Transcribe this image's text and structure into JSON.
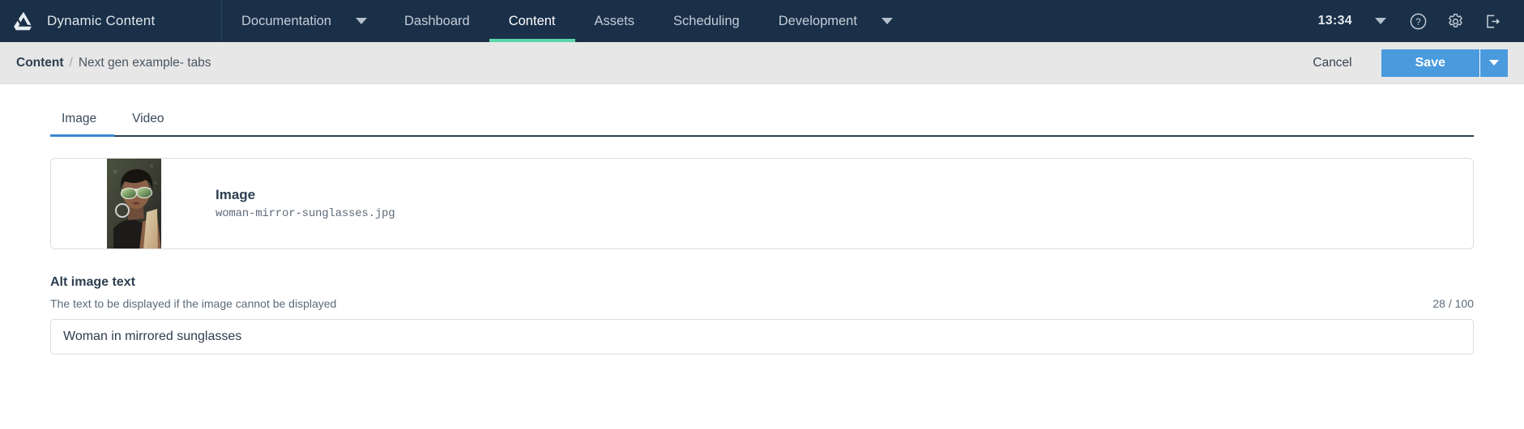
{
  "topnav": {
    "logo_icon": "amplience-triangle-logo-icon",
    "brand": "Dynamic Content",
    "items": [
      {
        "label": "Documentation",
        "caret": true,
        "active": false
      },
      {
        "label": "Dashboard",
        "caret": false,
        "active": false
      },
      {
        "label": "Content",
        "caret": false,
        "active": true
      },
      {
        "label": "Assets",
        "caret": false,
        "active": false
      },
      {
        "label": "Scheduling",
        "caret": false,
        "active": false
      },
      {
        "label": "Development",
        "caret": true,
        "active": false
      }
    ],
    "clock": "13:34",
    "user_caret_icon": "chevron-down-icon",
    "help_icon": "help-circle-icon",
    "settings_icon": "gear-icon",
    "logout_icon": "logout-icon",
    "active_underline_color": "#5ad6ab",
    "background_color": "#1a3049"
  },
  "subbar": {
    "breadcrumb": {
      "root": "Content",
      "separator": "/",
      "leaf": "Next gen example- tabs"
    },
    "cancel_label": "Cancel",
    "save_label": "Save",
    "save_caret_icon": "chevron-down-icon",
    "save_color": "#4a9ade"
  },
  "main": {
    "tabs": [
      {
        "label": "Image",
        "active": true
      },
      {
        "label": "Video",
        "active": false
      }
    ],
    "tab_active_color": "#3b87d4",
    "asset": {
      "title": "Image",
      "filename": "woman-mirror-sunglasses.jpg",
      "thumbnail_alt": "woman-in-mirrored-sunglasses-thumbnail"
    },
    "alt_field": {
      "label": "Alt image text",
      "help": "The text to be displayed if the image cannot be displayed",
      "counter": "28 / 100",
      "value": "Woman in mirrored sunglasses",
      "placeholder": ""
    }
  }
}
